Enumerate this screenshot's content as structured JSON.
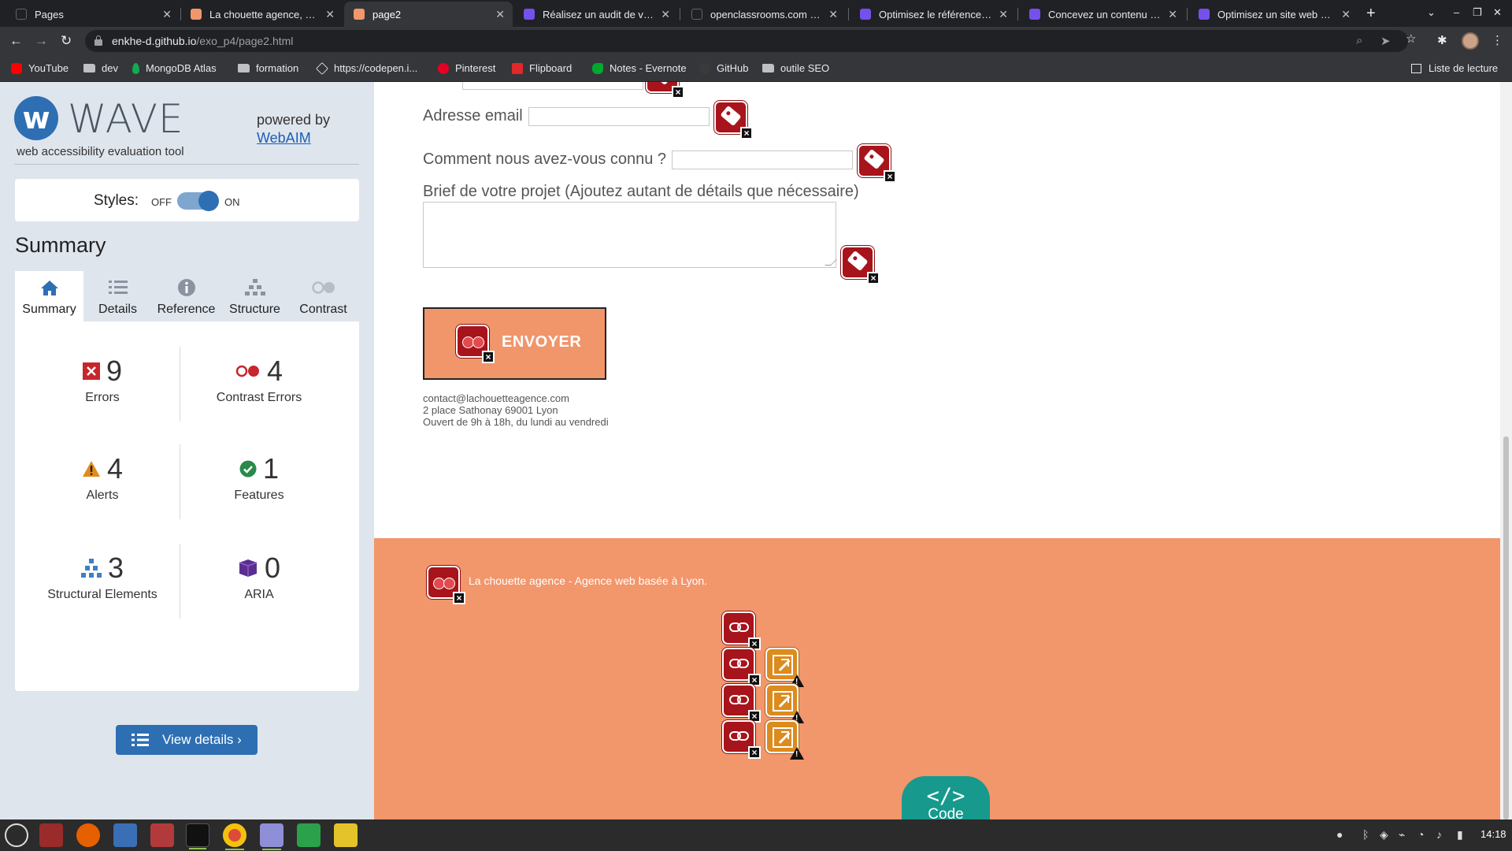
{
  "browser": {
    "tabs": [
      {
        "title": "Pages",
        "active": false,
        "favicon_color": "#202124"
      },
      {
        "title": "La chouette agence, agence web",
        "active": false,
        "favicon_color": "#f2966b"
      },
      {
        "title": "page2",
        "active": true,
        "favicon_color": "#f2966b"
      },
      {
        "title": "Réalisez un audit de votre site",
        "active": false,
        "favicon_color": "#7451eb"
      },
      {
        "title": "openclassrooms.com - Site",
        "active": false,
        "favicon_color": "#202124"
      },
      {
        "title": "Optimisez le référencement",
        "active": false,
        "favicon_color": "#7451eb"
      },
      {
        "title": "Concevez un contenu web",
        "active": false,
        "favicon_color": "#7451eb"
      },
      {
        "title": "Optimisez un site web existant",
        "active": false,
        "favicon_color": "#7451eb"
      }
    ],
    "url_host": "enkhe-d.github.io",
    "url_path": "/exo_p4/page2.html",
    "bookmarks": [
      {
        "label": "YouTube",
        "icon": "youtube-icon",
        "color": "#ff0000"
      },
      {
        "label": "dev",
        "icon": "folder-icon"
      },
      {
        "label": "MongoDB Atlas",
        "icon": "mongodb-icon",
        "color": "#13aa52"
      },
      {
        "label": "formation",
        "icon": "folder-icon"
      },
      {
        "label": "https://codepen.i...",
        "icon": "codepen-icon",
        "color": "#ffffff"
      },
      {
        "label": "Pinterest",
        "icon": "pinterest-icon",
        "color": "#e60023"
      },
      {
        "label": "Flipboard",
        "icon": "flipboard-icon",
        "color": "#e12828"
      },
      {
        "label": "Notes - Evernote",
        "icon": "evernote-icon",
        "color": "#00a82d"
      },
      {
        "label": "GitHub",
        "icon": "github-icon",
        "color": "#24292e"
      },
      {
        "label": "outile SEO",
        "icon": "folder-icon"
      }
    ],
    "reading_list": "Liste de lecture"
  },
  "wave": {
    "title": "WAVE",
    "subtitle": "web accessibility evaluation tool",
    "powered_by": "powered by",
    "webaim": "WebAIM",
    "styles_label": "Styles:",
    "off": "OFF",
    "on": "ON",
    "summary_heading": "Summary",
    "tabs": [
      "Summary",
      "Details",
      "Reference",
      "Structure",
      "Contrast"
    ],
    "active_tab": "Summary",
    "stats": {
      "errors": {
        "count": "9",
        "label": "Errors"
      },
      "contrast": {
        "count": "4",
        "label": "Contrast Errors"
      },
      "alerts": {
        "count": "4",
        "label": "Alerts"
      },
      "features": {
        "count": "1",
        "label": "Features"
      },
      "structure": {
        "count": "3",
        "label": "Structural Elements"
      },
      "aria": {
        "count": "0",
        "label": "ARIA"
      }
    },
    "view_details": "View details ›",
    "accent": "#2e6fb3"
  },
  "page": {
    "email_label": "Adresse email",
    "source_label": "Comment nous avez-vous connu ?",
    "brief_label": "Brief de votre projet (Ajoutez autant de détails que nécessaire)",
    "send_label": "ENVOYER",
    "contact": {
      "email": "contact@lachouetteagence.com",
      "address": "2 place Sathonay 69001 Lyon",
      "hours": "Ouvert de 9h à 18h, du lundi au vendredi"
    },
    "footer_text": "La chouette agence - Agence web basée à Lyon.",
    "footer_color": "#f2966b",
    "code_label": "Code",
    "code_glyph": "</>"
  },
  "taskbar": {
    "time": "14:18"
  }
}
